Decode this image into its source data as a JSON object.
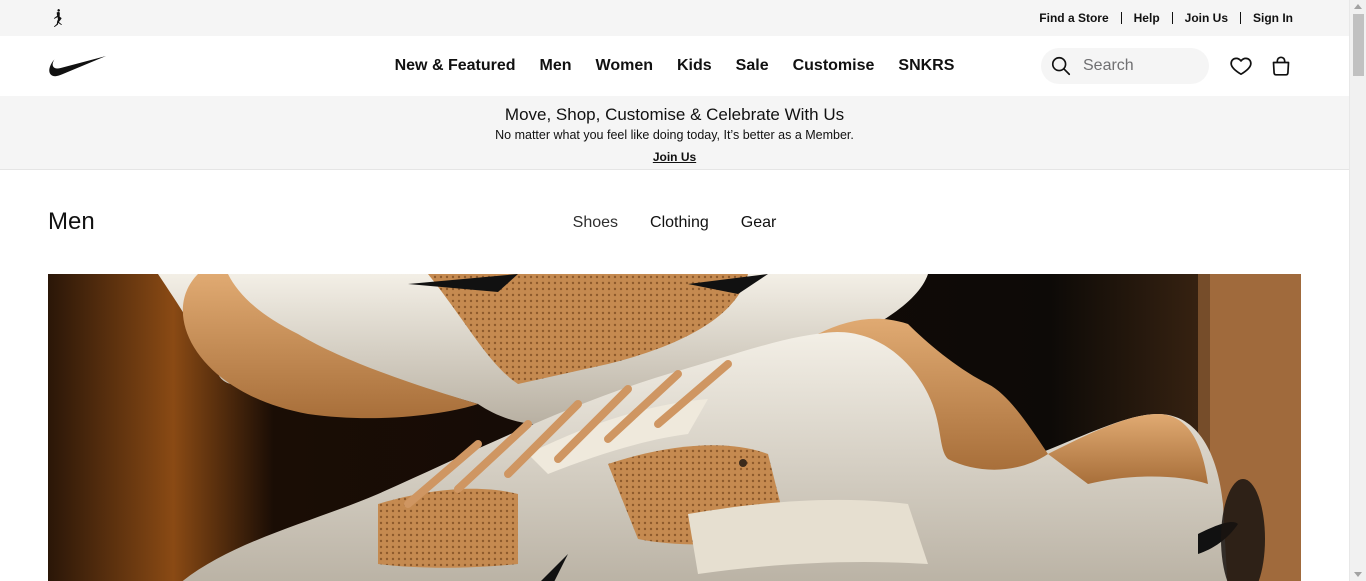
{
  "utility": {
    "brand_icon": "jordan-jumpman-icon",
    "links": [
      "Find a Store",
      "Help",
      "Join Us",
      "Sign In"
    ]
  },
  "nav": {
    "logo": "nike-swoosh-logo",
    "items": [
      "New & Featured",
      "Men",
      "Women",
      "Kids",
      "Sale",
      "Customise",
      "SNKRS"
    ],
    "search_placeholder": "Search",
    "icons": [
      "search-icon",
      "heart-icon",
      "bag-icon"
    ]
  },
  "promo": {
    "title": "Move, Shop, Customise & Celebrate With Us",
    "subtitle": "No matter what you feel like doing today, It’s better as a Member.",
    "link": "Join Us"
  },
  "section": {
    "title": "Men",
    "tabs": [
      "Shoes",
      "Clothing",
      "Gear"
    ]
  },
  "hero": {
    "description_icon": "hero-image"
  },
  "colors": {
    "text": "#111111",
    "bar_bg": "#f5f5f5",
    "hero_bg": "#1a0f08",
    "tan": "#c8915a",
    "silver": "#d9d4c8"
  }
}
